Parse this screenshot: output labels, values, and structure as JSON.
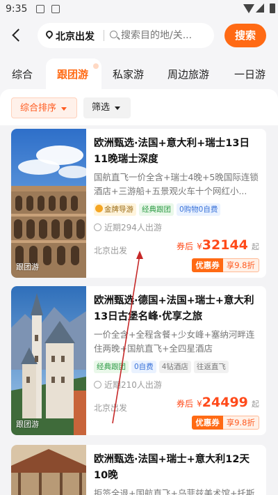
{
  "status_bar": {
    "time": "9:35"
  },
  "search": {
    "departure": "北京出发",
    "placeholder": "搜索目的地/关...",
    "button": "搜索"
  },
  "tabs": [
    {
      "label": "综合",
      "active": false
    },
    {
      "label": "跟团游",
      "active": true
    },
    {
      "label": "私家游",
      "active": false
    },
    {
      "label": "周边旅游",
      "active": false
    },
    {
      "label": "一日游",
      "active": false
    }
  ],
  "sort_bar": {
    "sort_label": "综合排序",
    "filter_label": "筛选"
  },
  "products": [
    {
      "title": "欧洲甄选·法国+意大利+瑞士13日11晚瑞士深度",
      "desc": "国航直飞一价全含+瑞士4晚+5晚国际连锁酒店+三游船+五景观火车十个网红小...",
      "badges": [
        {
          "text": "金牌导游",
          "style": "gold"
        },
        {
          "text": "经典跟团",
          "style": "green"
        },
        {
          "text": "0购物0自费",
          "style": "blue"
        }
      ],
      "travelers": "近期294人出游",
      "departure": "北京出发",
      "price_prefix": "券后",
      "currency": "¥",
      "price": "32144",
      "price_suffix": "起",
      "coupon_label": "优惠券",
      "coupon_discount": "享9.8折",
      "image_tag": "跟团游",
      "image_icon": "colosseum-image"
    },
    {
      "title": "欧洲甄选·德国+法国+瑞士+意大利13日古堡名峰·优享之旅",
      "desc": "一价全含+全程含餐+少女峰+塞纳河畔连住两晚+国航直飞+全四星酒店",
      "badges": [
        {
          "text": "经典跟团",
          "style": "green"
        },
        {
          "text": "0自费",
          "style": "blue"
        },
        {
          "text": "4钻酒店",
          "style": "grey"
        },
        {
          "text": "往返直飞",
          "style": "grey"
        }
      ],
      "travelers": "近期210人出游",
      "departure": "北京出发",
      "price_prefix": "券后",
      "currency": "¥",
      "price": "24499",
      "price_suffix": "起",
      "coupon_label": "优惠券",
      "coupon_discount": "享9.8折",
      "image_tag": "跟团游",
      "image_icon": "castle-image"
    },
    {
      "title": "欧洲甄选·法国+瑞士+意大利12天10晚",
      "desc": "拒签全退+国航直飞+乌菲兹美术馆+托斯卡纳",
      "image_icon": "bridge-image"
    }
  ],
  "colors": {
    "accent": "#ff6a14",
    "price": "#ff4a1a",
    "annotation_arrow": "#c62828"
  }
}
